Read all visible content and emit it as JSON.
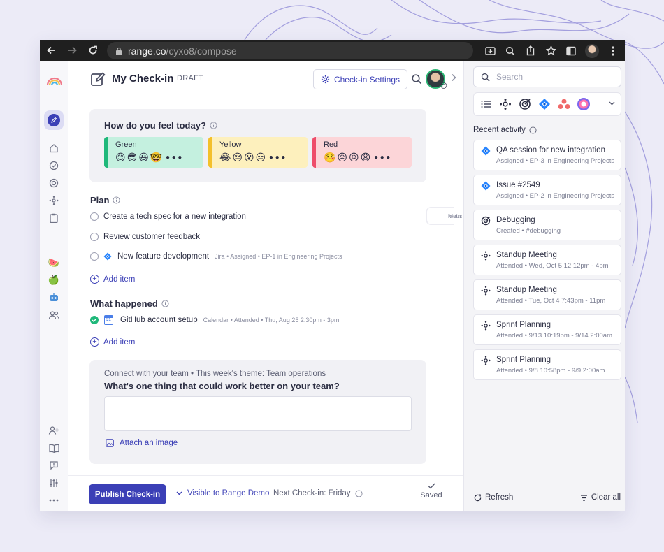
{
  "browser": {
    "url_host": "range.co",
    "url_path": "/cyxo8/compose"
  },
  "header": {
    "title": "My Check-in",
    "status": "DRAFT",
    "settings_label": "Check-in Settings",
    "avatar_emoji": "😊"
  },
  "mood": {
    "question": "How do you feel today?",
    "options": [
      {
        "label": "Green",
        "emojis": "😊😎😃🤓",
        "more": "•••",
        "color": "#1fb87a"
      },
      {
        "label": "Yellow",
        "emojis": "😂😔😮😑",
        "more": "•••",
        "color": "#f4c02b"
      },
      {
        "label": "Red",
        "emojis": "🤒😥😖😩",
        "more": "•••",
        "color": "#ee4d6a"
      }
    ]
  },
  "plan": {
    "heading": "Plan",
    "items": [
      {
        "text": "Create a tech spec for a new integration"
      },
      {
        "text": "Review customer feedback"
      },
      {
        "text": "New feature development",
        "meta": "Jira • Assigned • EP-1 in Engineering Projects"
      }
    ],
    "main_focus_line1": "Main",
    "main_focus_line2": "focus",
    "add_label": "Add item"
  },
  "happened": {
    "heading": "What happened",
    "items": [
      {
        "text": "GitHub account setup",
        "meta": "Calendar • Attended • Thu, Aug 25 2:30pm - 3pm",
        "calendar_day": "31"
      }
    ],
    "add_label": "Add item"
  },
  "team": {
    "subtitle": "Connect with your team • This week's theme: Team operations",
    "question": "What's one thing that could work better on your team?",
    "answer_value": "",
    "attach_label": "Attach an image"
  },
  "footer": {
    "publish_label": "Publish Check-in",
    "visibility_label": "Visible to Range Demo",
    "next_checkin": "Next Check-in: Friday",
    "saved_label": "Saved"
  },
  "sidebar_right": {
    "search_placeholder": "Search",
    "recent_heading": "Recent activity",
    "activity": [
      {
        "title": "QA session for new integration",
        "meta": "Assigned • EP-3 in Engineering Projects",
        "icon": "jira-icon"
      },
      {
        "title": "Issue #2549",
        "meta": "Assigned • EP-2 in Engineering Projects",
        "icon": "jira-icon"
      },
      {
        "title": "Debugging",
        "meta": "Created • #debugging",
        "icon": "target-icon"
      },
      {
        "title": "Standup Meeting",
        "meta": "Attended • Wed, Oct 5 12:12pm - 4pm",
        "icon": "meeting-icon"
      },
      {
        "title": "Standup Meeting",
        "meta": "Attended • Tue, Oct 4 7:43pm - 11pm",
        "icon": "meeting-icon"
      },
      {
        "title": "Sprint Planning",
        "meta": "Attended • 9/13 10:19pm - 9/14 2:00am",
        "icon": "meeting-icon"
      },
      {
        "title": "Sprint Planning",
        "meta": "Attended • 9/8 10:58pm - 9/9 2:00am",
        "icon": "meeting-icon"
      }
    ],
    "refresh_label": "Refresh",
    "clear_label": "Clear all"
  },
  "colors": {
    "accent": "#3b3fb6",
    "green": "#1fb87a",
    "page_bg": "#ecebf7"
  }
}
